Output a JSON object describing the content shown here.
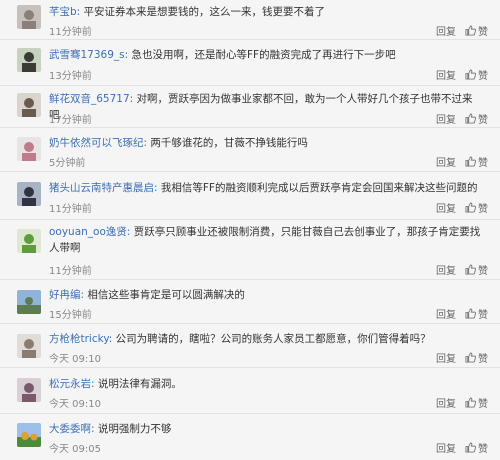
{
  "comments": [
    {
      "user": "芊宝b:",
      "text": "平安证券本来是想要钱的，这么一来，钱更要不着了",
      "time": "11分钟前",
      "reply": "回复",
      "like": "赞",
      "avatar_colors": [
        "#c6c1bd",
        "#8a7f7a"
      ]
    },
    {
      "user": "武雪骞17369_s:",
      "text": "急也没用啊，还是耐心等FF的融资完成了再进行下一步吧",
      "time": "13分钟前",
      "reply": "回复",
      "like": "赞",
      "avatar_colors": [
        "#c8d2c0",
        "#3a3a36"
      ]
    },
    {
      "user": "鲜花双音_65717:",
      "text": "对啊，贾跃亭因为做事业家都不回，敢为一个人带好几个孩子也带不过来吧",
      "time": "17分钟前",
      "reply": "回复",
      "like": "赞",
      "avatar_colors": [
        "#d9d4cc",
        "#6b5a50"
      ]
    },
    {
      "user": "奶牛依然可以飞琢纪:",
      "text": "两千够谁花的，甘薇不挣钱能行吗",
      "time": "5分钟前",
      "reply": "回复",
      "like": "赞",
      "avatar_colors": [
        "#e8e4e4",
        "#c07a8a"
      ]
    },
    {
      "user": "猪头山云南特产惠晨启:",
      "text": "我相信等FF的融资顺利完成以后贾跃亭肯定会回国来解决这些问题的",
      "time": "11分钟前",
      "reply": "回复",
      "like": "赞",
      "avatar_colors": [
        "#a8b4c4",
        "#2f3440"
      ]
    },
    {
      "user": "ooyuan_oo逸贤:",
      "text": "贾跃亭只顾事业还被限制消费，只能甘薇自己去创事业了，那孩子肯定要找人带啊",
      "time": "11分钟前",
      "reply": "回复",
      "like": "赞",
      "avatar_colors": [
        "#dfe8d0",
        "#5e9c3c"
      ]
    },
    {
      "user": "好冉编:",
      "text": "相信这些事肯定是可以圆满解决的",
      "time": "15分钟前",
      "reply": "回复",
      "like": "赞",
      "avatar_colors": [
        "#8fb4d8",
        "#5d7c52"
      ]
    },
    {
      "user": "方枪枪tricky:",
      "text": "公司为聘请的，瞎啦？公司的账务人家员工都愿意，你们管得着吗？",
      "time": "今天 09:10",
      "reply": "回复",
      "like": "赞",
      "avatar_colors": [
        "#e0ddd8",
        "#8a7d70"
      ]
    },
    {
      "user": "松元永岩:",
      "text": "说明法律有漏洞。",
      "time": "今天 09:10",
      "reply": "回复",
      "like": "赞",
      "avatar_colors": [
        "#d8d0d4",
        "#7a5a6a"
      ]
    },
    {
      "user": "大委委啊:",
      "text": "说明强制力不够",
      "time": "今天 09:05",
      "reply": "回复",
      "like": "赞",
      "avatar_colors": [
        "#9cc0e8",
        "#e0a030"
      ]
    }
  ]
}
